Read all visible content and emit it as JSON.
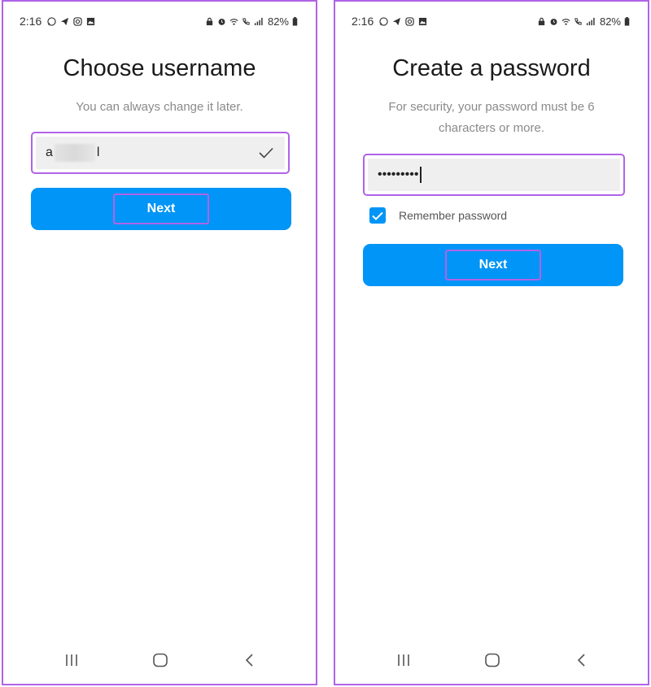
{
  "status_bar": {
    "time": "2:16",
    "battery": "82%",
    "icons": [
      "whatsapp-icon",
      "telegram-icon",
      "instagram-icon",
      "gallery-icon",
      "lock-icon",
      "alarm-icon",
      "wifi-icon",
      "call-icon",
      "signal-icon",
      "battery-icon"
    ]
  },
  "username_screen": {
    "title": "Choose username",
    "subtitle": "You can always change it later.",
    "input_prefix": "a",
    "input_suffix": "l",
    "next_label": "Next"
  },
  "password_screen": {
    "title": "Create a password",
    "subtitle": "For security, your password must be 6 characters or more.",
    "password_mask": "•••••••••",
    "remember_label": "Remember password",
    "remember_checked": true,
    "next_label": "Next"
  },
  "nav_bar": {
    "icons": [
      "recents-icon",
      "home-icon",
      "back-icon"
    ]
  },
  "colors": {
    "accent": "#0095f6",
    "highlight": "#b063e8"
  }
}
